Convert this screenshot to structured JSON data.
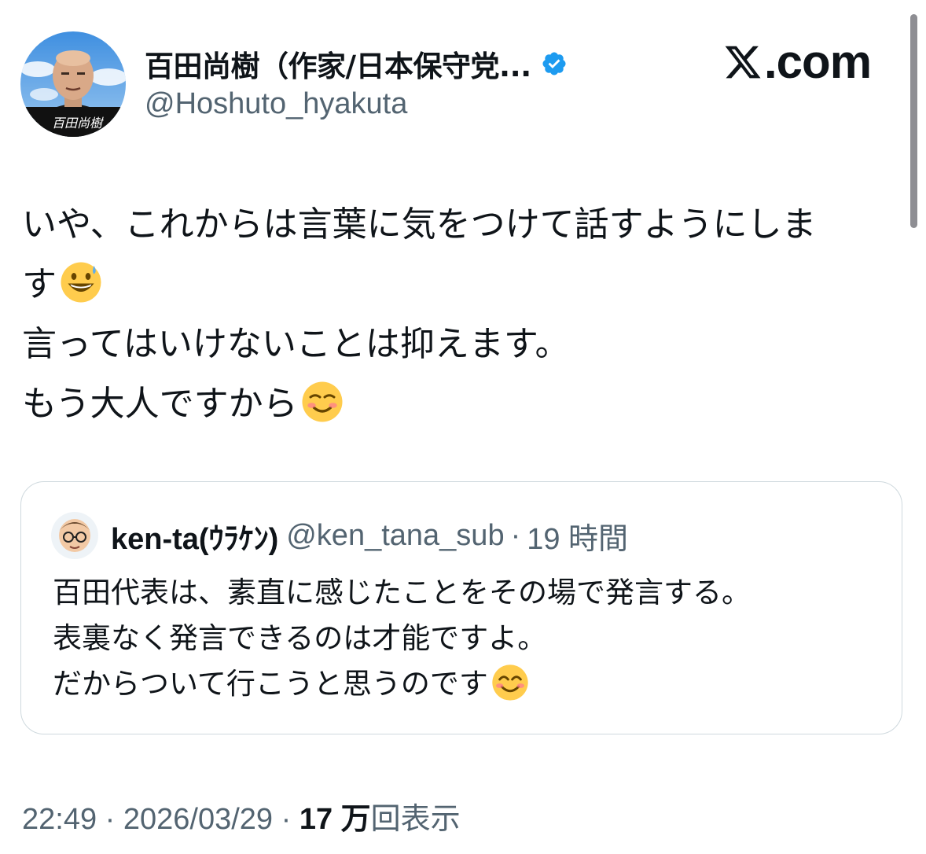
{
  "author": {
    "display_name": "百田尚樹（作家/日本保守党...",
    "handle": "@Hoshuto_hyakuta",
    "verified": true,
    "avatar_signature": "百田尚樹"
  },
  "brand": {
    "label": "X.com",
    "letter": "X",
    "suffix": ".com"
  },
  "tweet": {
    "lines": [
      "いや、これからは言葉に気をつけて話すようにしま",
      "す",
      "言ってはいけないことは抑えます。",
      "もう大人ですから"
    ],
    "emoji": [
      "grinning-face-with-sweat",
      "smiling-face"
    ]
  },
  "quote": {
    "name": "ken-ta(ｳﾗｹﾝ)",
    "handle": "@ken_tana_sub",
    "separator": "·",
    "time": "19 時間",
    "lines": [
      "百田代表は、素直に感じたことをその場で発言する。",
      "表裏なく発言できるのは才能ですよ。",
      "だからついて行こうと思うのです"
    ],
    "emoji": [
      "smiling-face-with-smiling-eyes"
    ]
  },
  "meta": {
    "time": "22:49",
    "separator": "·",
    "date": "2026/03/29",
    "views_count": "17 万",
    "views_label": "回表示"
  },
  "colors": {
    "text": "#0f1419",
    "secondary": "#536471",
    "border": "#cfd9de",
    "verified": "#1d9bf0"
  }
}
